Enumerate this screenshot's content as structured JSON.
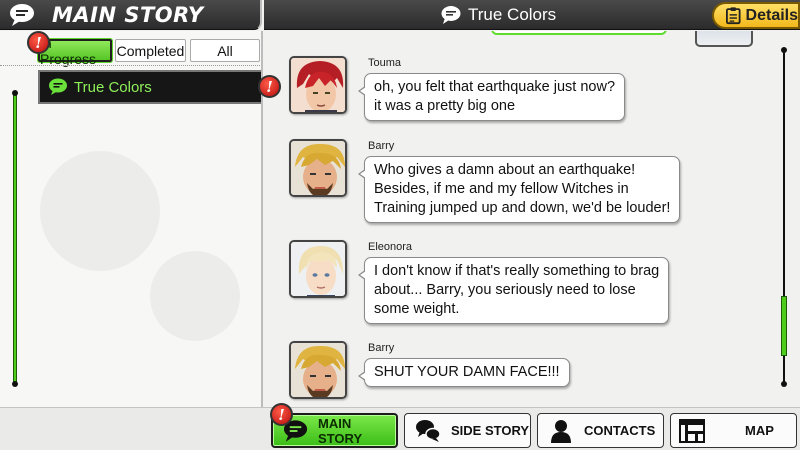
{
  "left_header": {
    "title": "MAIN STORY",
    "icon": "speech-bubble-icon"
  },
  "top_bar": {
    "title": "True Colors",
    "details_label": "Details"
  },
  "filters": [
    {
      "label": "In Progress",
      "active": true
    },
    {
      "label": "Completed",
      "active": false
    },
    {
      "label": "All",
      "active": false
    }
  ],
  "story_list": [
    {
      "label": "True Colors",
      "alert": "!"
    }
  ],
  "badges": {
    "alert_symbol": "!"
  },
  "messages": [
    {
      "speaker": "Touma",
      "lines": [
        "oh, you felt that earthquake just now?",
        "it was a pretty big one"
      ]
    },
    {
      "speaker": "Barry",
      "lines": [
        "Who gives a damn about an earthquake!",
        "Besides, if me and my fellow Witches in",
        "Training jumped up and down, we'd be louder!"
      ]
    },
    {
      "speaker": "Eleonora",
      "lines": [
        "I don't know if that's really something to brag",
        "about... Barry, you seriously need to lose",
        "some weight."
      ]
    },
    {
      "speaker": "Barry",
      "lines": [
        "SHUT YOUR DAMN FACE!!!"
      ]
    }
  ],
  "nav": [
    {
      "label": "MAIN STORY",
      "icon": "speech-bubble-icon",
      "active": true
    },
    {
      "label": "SIDE STORY",
      "icon": "chat-bubbles-icon",
      "active": false
    },
    {
      "label": "CONTACTS",
      "icon": "person-icon",
      "active": false
    },
    {
      "label": "MAP",
      "icon": "map-icon",
      "active": false
    }
  ],
  "colors": {
    "accent_green": "#56c626",
    "header_dark": "#2b2b2b",
    "alert_red": "#c41414",
    "details_yellow": "#f2b81c"
  }
}
